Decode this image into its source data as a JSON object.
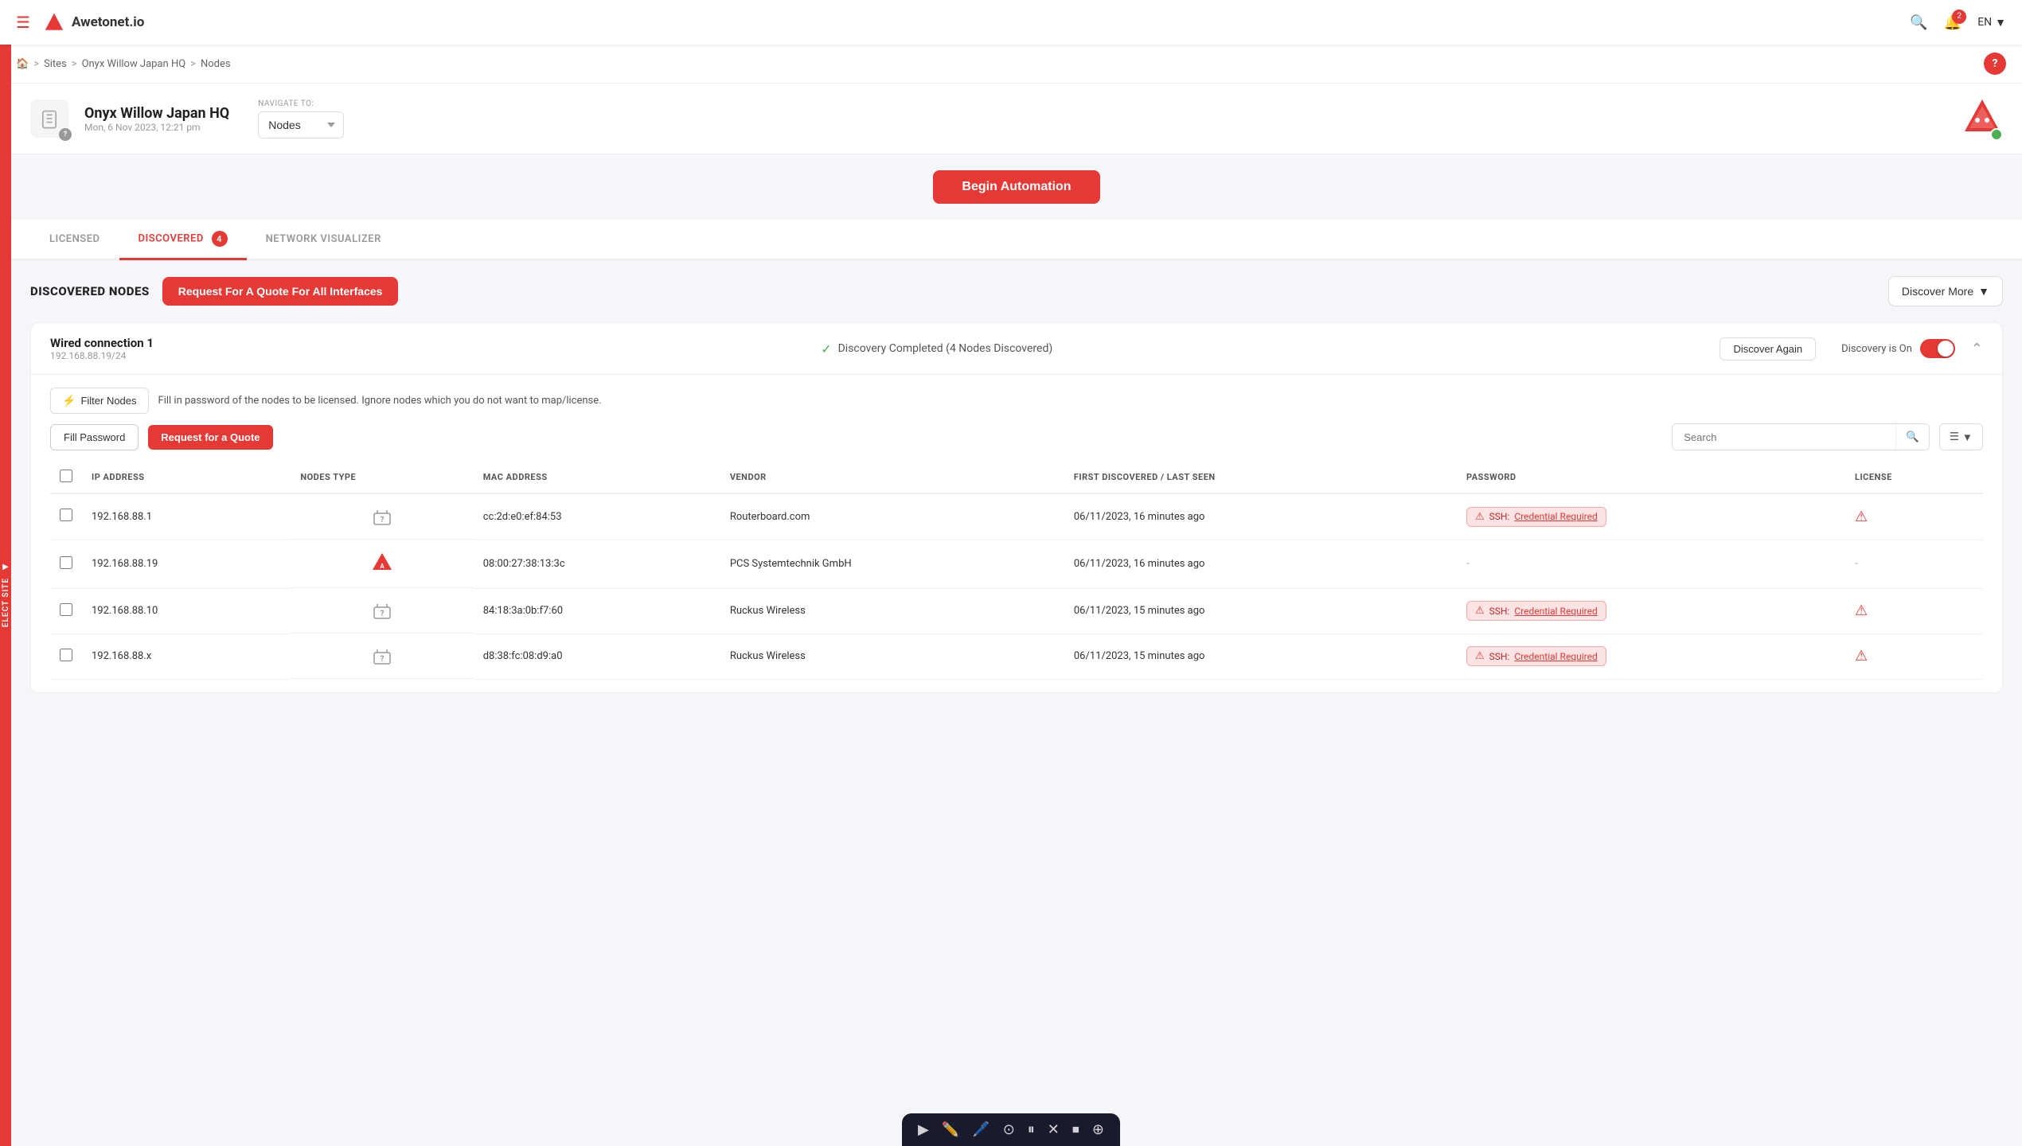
{
  "nav": {
    "brand": "Awetonet.io",
    "bell_count": "2",
    "lang": "EN"
  },
  "breadcrumb": {
    "home": "🏠",
    "sites": "Sites",
    "site": "Onyx Willow Japan HQ",
    "current": "Nodes"
  },
  "page_header": {
    "site_name": "Onyx Willow Japan HQ",
    "date": "Mon, 6 Nov 2023, 12:21 pm",
    "navigate_label": "NAVIGATE TO:",
    "navigate_value": "Nodes"
  },
  "automation": {
    "btn_label": "Begin Automation"
  },
  "tabs": [
    {
      "id": "licensed",
      "label": "LICENSED",
      "active": false,
      "badge": null
    },
    {
      "id": "discovered",
      "label": "DISCOVERED",
      "active": true,
      "badge": "4"
    },
    {
      "id": "network_visualizer",
      "label": "NETWORK VISUALIZER",
      "active": false,
      "badge": null
    }
  ],
  "discovered_nodes": {
    "title": "DISCOVERED NODES",
    "quote_all_btn": "Request For A Quote For All Interfaces",
    "discover_more_btn": "Discover More",
    "connection": {
      "name": "Wired connection 1",
      "ip": "192.168.88.19/24",
      "status_text": "Discovery Completed (4 Nodes Discovered)",
      "discover_again_btn": "Discover Again",
      "discovery_toggle_label": "Discovery is On"
    },
    "filter_btn": "Filter Nodes",
    "fill_info": "Fill in password of the nodes to be licensed. Ignore nodes which you do not want to map/license.",
    "table_controls": {
      "fill_password_btn": "Fill Password",
      "request_quote_btn": "Request for a Quote",
      "search_placeholder": "Search"
    },
    "table_headers": [
      "IP ADDRESS",
      "NODES TYPE",
      "MAC ADDRESS",
      "VENDOR",
      "FIRST DISCOVERED / LAST SEEN",
      "PASSWORD",
      "LICENSE"
    ],
    "rows": [
      {
        "ip": "192.168.88.1",
        "node_type": "question",
        "mac": "cc:2d:e0:ef:84:53",
        "vendor": "Routerboard.com",
        "first_seen": "06/11/2023, 16 minutes ago",
        "password_status": "SSH: Credential Required",
        "license": "warning"
      },
      {
        "ip": "192.168.88.19",
        "node_type": "aweton",
        "mac": "08:00:27:38:13:3c",
        "vendor": "PCS Systemtechnik GmbH",
        "first_seen": "06/11/2023, 16 minutes ago",
        "password_status": "-",
        "license": "-"
      },
      {
        "ip": "192.168.88.10",
        "node_type": "question",
        "mac": "84:18:3a:0b:f7:60",
        "vendor": "Ruckus Wireless",
        "first_seen": "06/11/2023, 15 minutes ago",
        "password_status": "SSH: Credential Required",
        "license": "warning"
      },
      {
        "ip": "192.168.88.x",
        "node_type": "question",
        "mac": "d8:38:fc:08:d9:a0",
        "vendor": "Ruckus Wireless",
        "first_seen": "06/11/2023, 15 minutes ago",
        "password_status": "SSH: Credential Required",
        "license": "warning"
      }
    ]
  },
  "side_panel": {
    "label": "ELECT SITE"
  },
  "bottom_toolbar": {
    "icons": [
      "cursor",
      "pencil",
      "highlighter",
      "node",
      "pause",
      "close",
      "stop"
    ]
  }
}
